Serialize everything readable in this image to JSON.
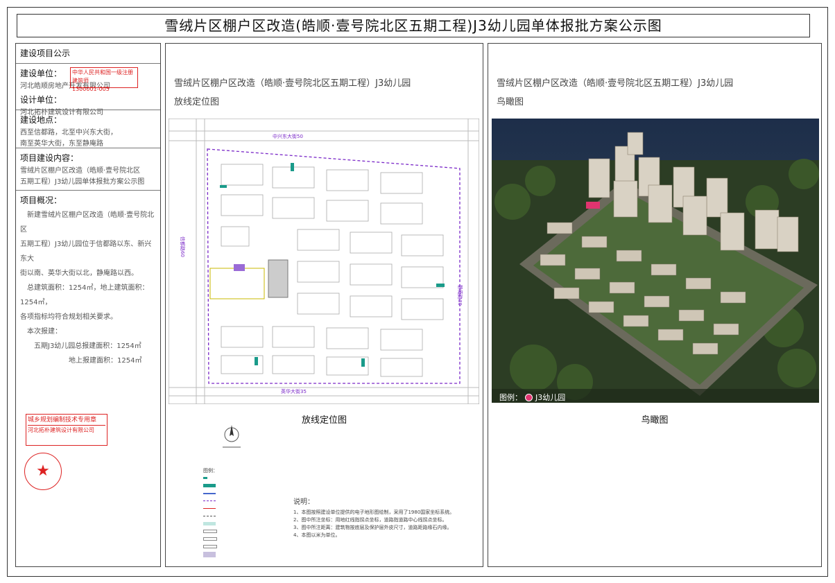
{
  "title": "雪绒片区棚户区改造(皓顺·壹号院北区五期工程)J3幼儿园单体报批方案公示图",
  "left": {
    "announce_heading": "建设项目公示",
    "builder_label": "建设单位：",
    "builder_value": "河北皓顺房地产开发有限公司",
    "designer_label": "设计单位：",
    "designer_value": "河北拓朴建筑设计有限公司",
    "site_label": "建设地点：",
    "site_line1": "西至信都路，北至中兴东大街，",
    "site_line2": "南至英华大街，东至静庵路",
    "content_label": "项目建设内容：",
    "content_line1": "雪绒片区棚户区改造（皓顺·壹号院北区",
    "content_line2": "五期工程）J3幼儿园单体报批方案公示图",
    "overview_label": "项目概况：",
    "overview_p1": "新建雪绒片区棚户区改造（皓顺·壹号院北区",
    "overview_p2": "五期工程）J3幼儿园位于信都路以东、新兴东大",
    "overview_p3": "街以南、英华大街以北，静庵路以西。",
    "overview_p4": "总建筑面积：1254㎡，地上建筑面积：1254㎡，",
    "overview_p5": "各项指标均符合规划相关要求。",
    "overview_p6": "本次报建：",
    "overview_p7": "五期J3幼儿园总报建面积：1254㎡",
    "overview_p8": "地上报建面积：1254㎡",
    "stamp1_line1": "中华人民共和国一级注册建筑师",
    "stamp1_line2": "1300001-005",
    "stamp2_line1": "城乡规划编制技术专用章",
    "stamp2_line2": "河北拓朴建筑设计有限公司",
    "stamp3_center": "★"
  },
  "plan": {
    "title_line1": "雪绒片区棚户区改造（皓顺·壹号院北区五期工程）J3幼儿园",
    "title_line2": "放线定位图",
    "caption": "放线定位图",
    "road_north": "中兴东大街50",
    "road_south": "英华大街35",
    "road_west": "信都路60",
    "road_east": "静庵路30",
    "legend_title": "图例：",
    "notes_title": "说明：",
    "notes": [
      "1、本图按照建设单位提供的电子地形图绘制，采用了1980国家坐标系统。",
      "2、图中所注坐标：用地红线指拐点坐标，道路指道路中心线拐点坐标。",
      "3、图中所注距离：建筑物按底层及保护层外皮尺寸，道路距路缘石内缘。",
      "4、本图以米为单位。"
    ]
  },
  "aerial": {
    "title_line1": "雪绒片区棚户区改造（皓顺·壹号院北区五期工程）J3幼儿园",
    "title_line2": "鸟瞰图",
    "caption": "鸟瞰图",
    "legend_label": "图例：",
    "legend_item": "J3幼儿园"
  },
  "colors": {
    "stamp_red": "#d22222",
    "boundary_purple": "#7a28c8",
    "teal_marker": "#1a9b8a",
    "kindergarten_pink": "#e0346f"
  }
}
